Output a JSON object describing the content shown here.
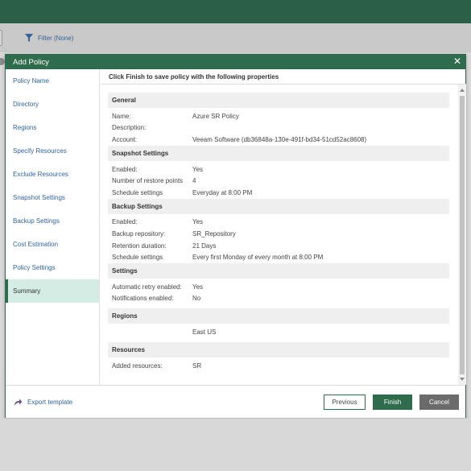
{
  "toolbar": {
    "filter_label": "Filter (None)"
  },
  "dialog": {
    "title": "Add Policy",
    "header": "Click Finish to save policy with the following properties",
    "close_glyph": "✕"
  },
  "sidebar": {
    "items": [
      {
        "label": "Policy Name"
      },
      {
        "label": "Directory"
      },
      {
        "label": "Regions"
      },
      {
        "label": "Specify Resources"
      },
      {
        "label": "Exclude Resources"
      },
      {
        "label": "Snapshot Settings"
      },
      {
        "label": "Backup Settings"
      },
      {
        "label": "Cost Estimation"
      },
      {
        "label": "Policy Settings"
      },
      {
        "label": "Summary"
      }
    ]
  },
  "summary": {
    "general": {
      "title": "General",
      "rows": [
        {
          "label": "Name:",
          "value": "Azure SR Policy"
        },
        {
          "label": "Description:",
          "value": ""
        },
        {
          "label": "Account:",
          "value": "Veeam Software (db36848a-130e-491f-bd34-51cd52ac8608)"
        }
      ]
    },
    "snapshot": {
      "title": "Snapshot Settings",
      "rows": [
        {
          "label": "Enabled:",
          "value": "Yes"
        },
        {
          "label": "Number of restore points",
          "value": "4"
        },
        {
          "label": "Schedule settings",
          "value": "Everyday at 8:00 PM"
        }
      ]
    },
    "backup": {
      "title": "Backup Settings",
      "rows": [
        {
          "label": "Enabled:",
          "value": "Yes"
        },
        {
          "label": "Backup repository:",
          "value": "SR_Repository"
        },
        {
          "label": "Retention duration:",
          "value": "21 Days"
        },
        {
          "label": "Schedule settings",
          "value": "Every first Monday of every month at 8:00 PM"
        }
      ]
    },
    "settings": {
      "title": "Settings",
      "rows": [
        {
          "label": "Automatic retry enabled:",
          "value": "Yes"
        },
        {
          "label": "Notifications enabled:",
          "value": "No"
        }
      ]
    },
    "regions": {
      "title": "Regions",
      "rows": [
        {
          "label": "",
          "value": "East US"
        }
      ]
    },
    "resources": {
      "title": "Resources",
      "rows": [
        {
          "label": "Added resources:",
          "value": "SR"
        }
      ]
    }
  },
  "footer": {
    "export_label": "Export template",
    "previous_label": "Previous",
    "finish_label": "Finish",
    "cancel_label": "Cancel"
  },
  "colors": {
    "brand_green": "#2f6c4d",
    "link_blue": "#2f64a0",
    "active_nav_bg": "#d4ece3"
  }
}
